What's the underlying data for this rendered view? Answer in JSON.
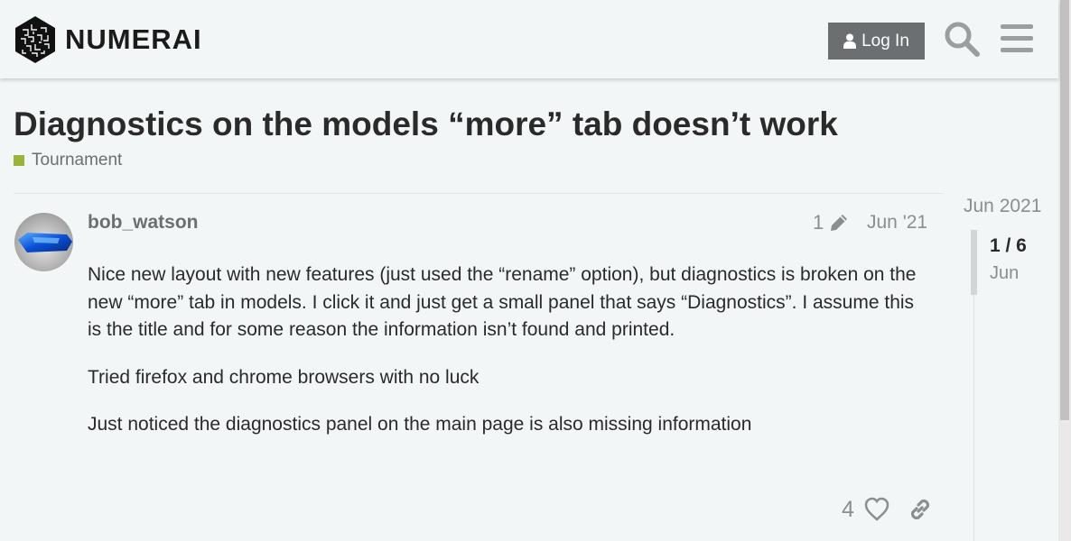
{
  "header": {
    "brand": "NUMERAI",
    "login_label": "Log In"
  },
  "topic": {
    "title": "Diagnostics on the models “more” tab doesn’t work",
    "category": "Tournament",
    "category_color": "#9ab33a"
  },
  "post": {
    "username": "bob_watson",
    "edit_count": "1",
    "date": "Jun '21",
    "paragraphs": [
      "Nice new layout with new features (just used the “rename” option), but diagnostics is broken on the new “more” tab in models. I click it and just get a small panel that says “Diagnostics”. I assume this is the title and for some reason the information isn’t found and printed.",
      "Tried firefox and chrome browsers with no luck",
      "Just noticed the diagnostics panel on the main page is also missing information"
    ],
    "like_count": "4"
  },
  "timeline": {
    "start_date": "Jun 2021",
    "position": "1 / 6",
    "current_date": "Jun"
  },
  "icons": {
    "logo": "numerai-cube-logo",
    "login": "user-icon",
    "search": "search-icon",
    "menu": "hamburger-menu-icon",
    "edit": "pencil-icon",
    "like": "heart-icon",
    "share": "link-icon"
  },
  "colors": {
    "button_bg": "#6b6f72",
    "muted_text": "#8a8e91"
  }
}
